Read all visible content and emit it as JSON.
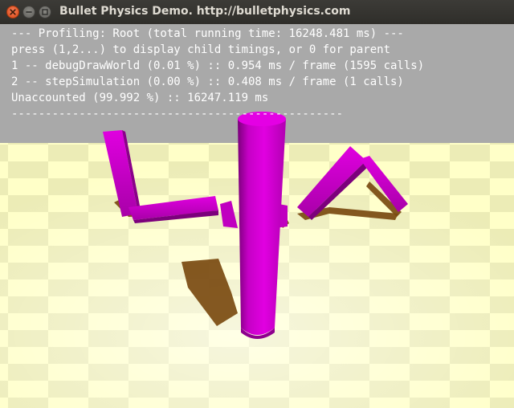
{
  "window": {
    "title": "Bullet Physics Demo. http://bulletphysics.com",
    "buttons": [
      "close",
      "minimize",
      "maximize"
    ]
  },
  "profiler": {
    "lines": [
      "--- Profiling: Root (total running time: 16248.481 ms) ---",
      "press (1,2...) to display child timings, or 0 for parent",
      "1 -- debugDrawWorld (0.01 %) :: 0.954 ms / frame (1595 calls)",
      "2 -- stepSimulation (0.00 %) :: 0.408 ms / frame (1 calls)",
      "Unaccounted (99.992 %) :: 16247.119 ms",
      "-------------------------------------------------"
    ]
  },
  "scene": {
    "sky_color": "#a9a9a9",
    "floor_light": "#ffffcc",
    "floor_dark": "#e8e8b0",
    "body_color": "#cc00cc",
    "shadow_color": "#7a4a10",
    "objects": [
      "central-capsule",
      "left-limb",
      "right-limb"
    ]
  }
}
